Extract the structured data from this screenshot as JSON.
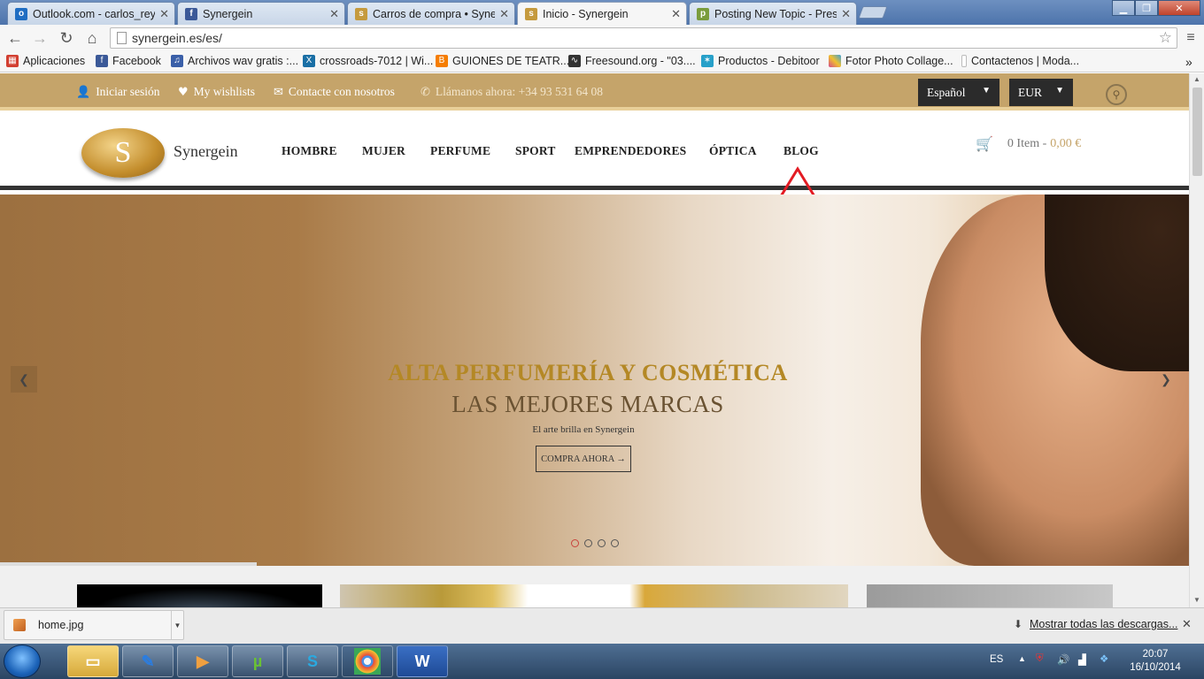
{
  "browser": {
    "tabs": [
      {
        "label": "Outlook.com - carlos_reye",
        "favicon": "outlook-icon",
        "color": "#1f6dc2",
        "active": false
      },
      {
        "label": "Synergein",
        "favicon": "facebook-icon",
        "color": "#3b5998",
        "active": false
      },
      {
        "label": "Carros de compra • Synerg",
        "favicon": "synergein-icon",
        "color": "#c59a3d",
        "active": false
      },
      {
        "label": "Inicio - Synergein",
        "favicon": "synergein-icon",
        "color": "#c59a3d",
        "active": true
      },
      {
        "label": "Posting New Topic - Prest",
        "favicon": "prestashop-icon",
        "color": "#7a9c3c",
        "active": false
      }
    ],
    "url": "synergein.es/es/",
    "bookmarks": [
      {
        "label": "Aplicaciones",
        "icon": "apps-grid-icon",
        "color": "#d23f31"
      },
      {
        "label": "Facebook",
        "icon": "facebook-icon",
        "color": "#3b5998"
      },
      {
        "label": "Archivos wav gratis :...",
        "icon": "wav-icon",
        "color": "#3a5fa8"
      },
      {
        "label": "crossroads-7012 | Wi...",
        "icon": "xing-icon",
        "color": "#1a6fa5"
      },
      {
        "label": "GUIONES DE TEATR...",
        "icon": "blogger-icon",
        "color": "#f57d00"
      },
      {
        "label": "Freesound.org - \"03....",
        "icon": "freesound-icon",
        "color": "#333333"
      },
      {
        "label": "Productos - Debitoor",
        "icon": "debitoor-icon",
        "color": "#27a0c9"
      },
      {
        "label": "Fotor Photo Collage...",
        "icon": "fotor-icon",
        "color": "#d44a8b"
      },
      {
        "label": "Contactenos | Moda...",
        "icon": "page-icon",
        "color": "#8fb8e0"
      }
    ]
  },
  "site": {
    "topbar": {
      "login": "Iniciar sesión",
      "wishlist": "My wishlists",
      "contact": "Contacte con nosotros",
      "phone": "Llámanos ahora: +34 93 531 64 08",
      "language": "Español",
      "currency": "EUR"
    },
    "logo_text": "Synergein",
    "logo_letter": "S",
    "nav": [
      "HOMBRE",
      "MUJER",
      "PERFUME",
      "SPORT",
      "EMPRENDEDORES",
      "ÓPTICA",
      "BLOG"
    ],
    "cart": {
      "items": "0 Item -",
      "amount": "0,00 €"
    },
    "hero": {
      "title": "ALTA PERFUMERÍA Y COSMÉTICA",
      "subtitle": "LAS MEJORES MARCAS",
      "tagline": "El arte brilla en Synergein",
      "cta": "COMPRA AHORA →",
      "slides": 4,
      "active_slide": 1
    }
  },
  "downloads": {
    "file": "home.jpg",
    "show_all": "Mostrar todas las descargas..."
  },
  "taskbar": {
    "lang": "ES",
    "time": "20:07",
    "date": "16/10/2014"
  },
  "colors": {
    "gold": "#c5a46a",
    "accent_red": "#e31b23"
  }
}
